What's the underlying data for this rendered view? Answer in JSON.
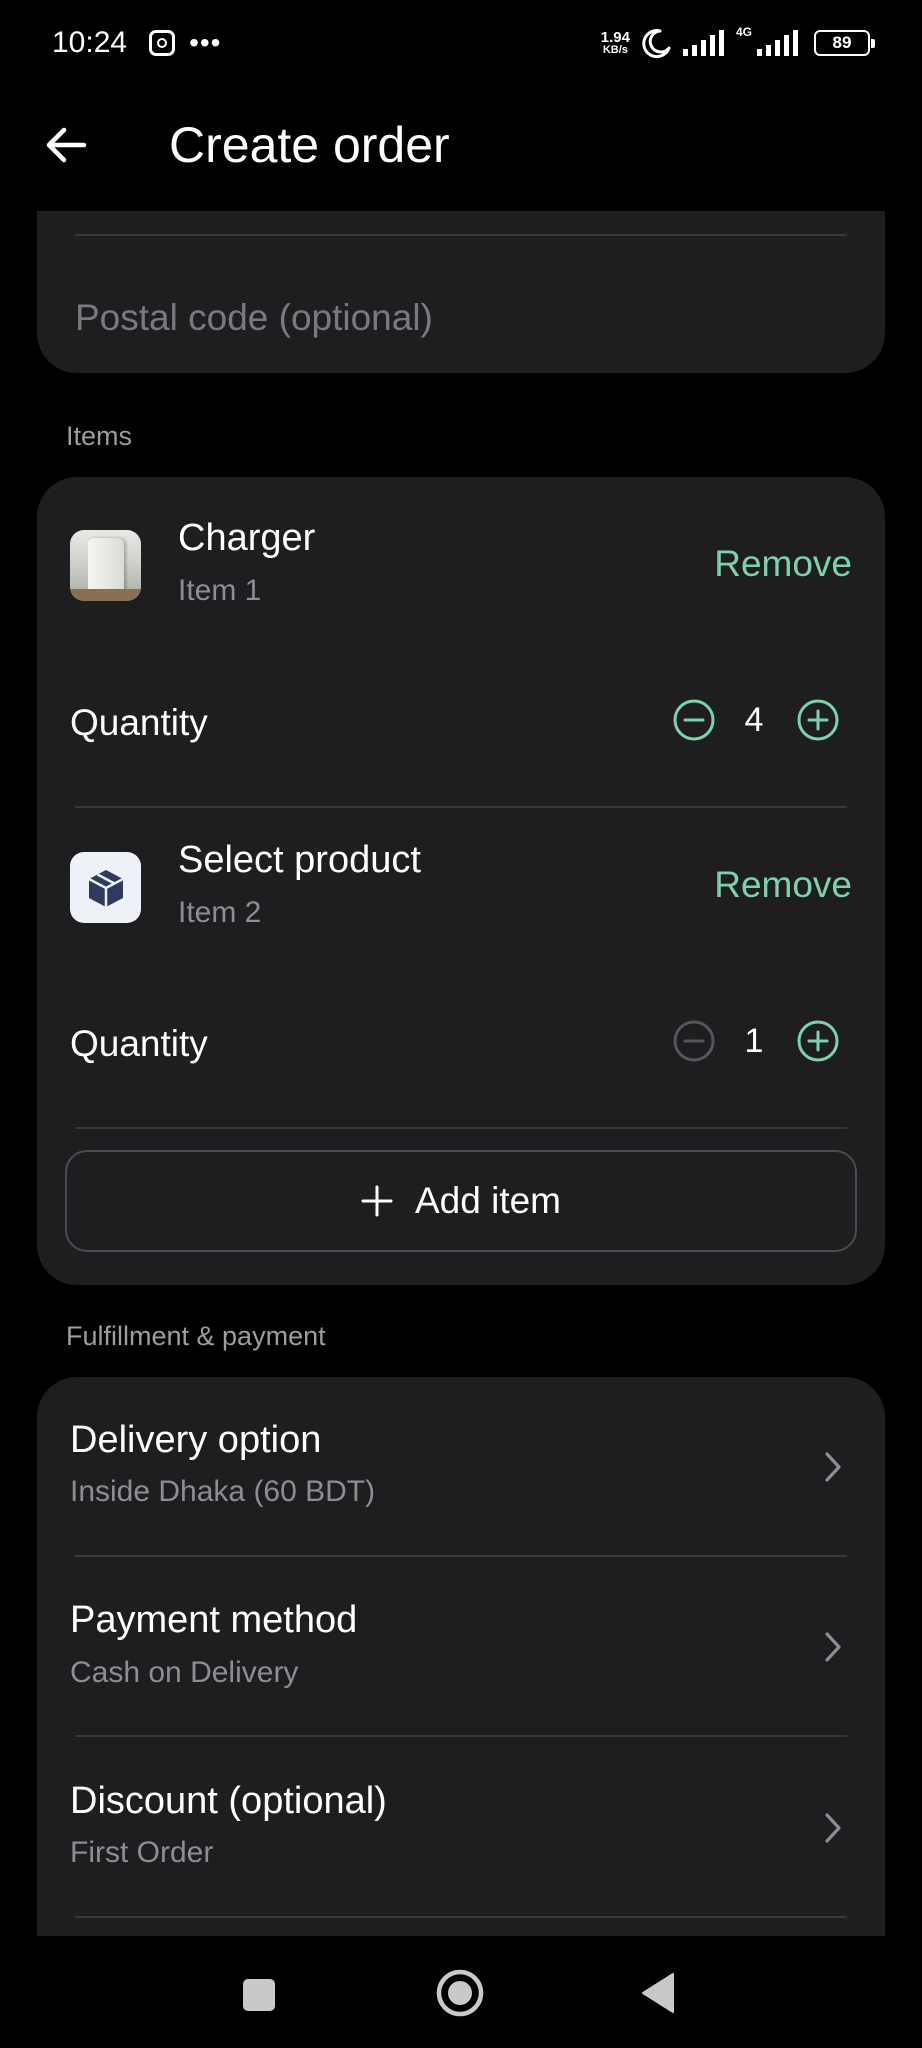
{
  "status_bar": {
    "time": "10:24",
    "dots": "•••",
    "net_speed_value": "1.94",
    "net_speed_unit": "KB/s",
    "network_type": "4G",
    "battery": "89"
  },
  "app_bar": {
    "title": "Create order"
  },
  "address": {
    "postal_placeholder": "Postal code (optional)"
  },
  "items_section": {
    "label": "Items",
    "items": [
      {
        "name": "Charger",
        "subtitle": "Item 1",
        "remove_label": "Remove",
        "quantity_label": "Quantity",
        "quantity": "4"
      },
      {
        "name": "Select product",
        "subtitle": "Item 2",
        "remove_label": "Remove",
        "quantity_label": "Quantity",
        "quantity": "1"
      }
    ],
    "add_item_label": "Add item"
  },
  "fulfillment_section": {
    "label": "Fulfillment & payment",
    "rows": [
      {
        "title": "Delivery option",
        "value": "Inside Dhaka (60 BDT)"
      },
      {
        "title": "Payment method",
        "value": "Cash on Delivery"
      },
      {
        "title": "Discount (optional)",
        "value": "First Order"
      }
    ]
  },
  "colors": {
    "accent": "#7ed2ab",
    "card": "#1e1e20",
    "background": "#000000",
    "muted_text": "#8d8d92"
  }
}
